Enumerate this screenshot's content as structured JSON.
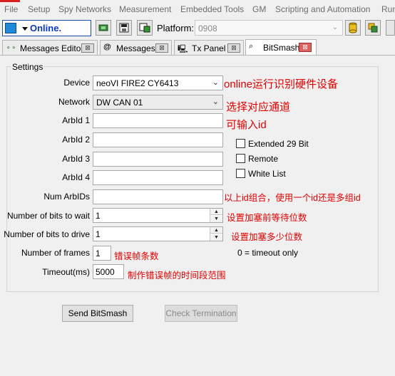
{
  "menu": [
    "File",
    "Setup",
    "Spy Networks",
    "Measurement",
    "Embedded Tools",
    "GM",
    "Scripting and Automation",
    "Run"
  ],
  "toolbar": {
    "status": "Online.",
    "platform_label": "Platform:",
    "platform_value": "0908"
  },
  "tabs": [
    {
      "label": "Messages Editor",
      "close": "⊠"
    },
    {
      "label": "Messages",
      "close": "⊠"
    },
    {
      "label": "Tx Panel",
      "close": "⊠"
    },
    {
      "label": "BitSmash",
      "close": "⊠"
    }
  ],
  "settings": {
    "legend": "Settings",
    "device_label": "Device",
    "device_value": "neoVI FIRE2 CY6413",
    "network_label": "Network",
    "network_value": "DW CAN 01",
    "arbid1_label": "ArbId 1",
    "arbid2_label": "ArbId 2",
    "arbid3_label": "ArbId 3",
    "arbid4_label": "ArbId 4",
    "num_arbids_label": "Num ArbIDs",
    "bits_wait_label": "Number of bits to wait",
    "bits_wait_value": "1",
    "bits_drive_label": "Number of bits to drive",
    "bits_drive_value": "1",
    "frames_label": "Number of frames",
    "frames_value": "1",
    "frames_hint": "0 = timeout only",
    "timeout_label": "Timeout(ms)",
    "timeout_value": "5000",
    "extended_label": "Extended 29 Bit",
    "remote_label": "Remote",
    "whitelist_label": "White List"
  },
  "notes": {
    "device": "online运行识别硬件设备",
    "network": "选择对应通道",
    "arbid": "可输入id",
    "num_arbids": "以上id组合，使用一个id还是多组id",
    "bits_wait": "设置加塞前等待位数",
    "bits_drive": "设置加塞多少位数",
    "frames": "错误帧条数",
    "timeout": "制作错误帧的时间段范围"
  },
  "buttons": {
    "send": "Send BitSmash",
    "check": "Check Termination"
  }
}
